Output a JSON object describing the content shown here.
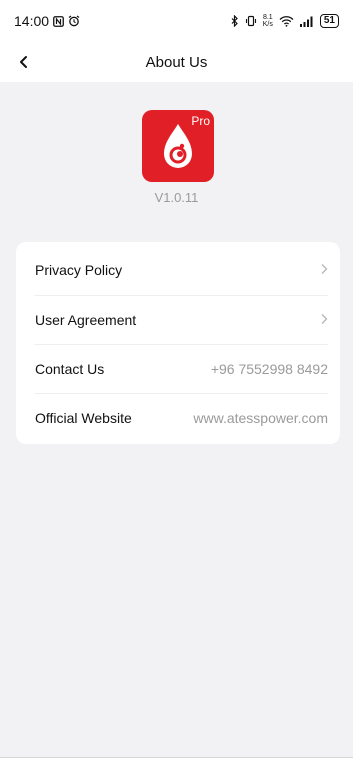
{
  "status_bar": {
    "time": "14:00",
    "net_speed_top": "8.1",
    "net_speed_bottom": "K/s",
    "battery": "51"
  },
  "header": {
    "title": "About Us"
  },
  "app": {
    "logo_badge": "Pro",
    "version": "V1.0.11",
    "brand_color": "#e01f26"
  },
  "menu": {
    "privacy_policy": "Privacy Policy",
    "user_agreement": "User Agreement",
    "contact_label": "Contact Us",
    "contact_value": "+96 7552998 8492",
    "website_label": "Official Website",
    "website_value": "www.atesspower.com"
  }
}
